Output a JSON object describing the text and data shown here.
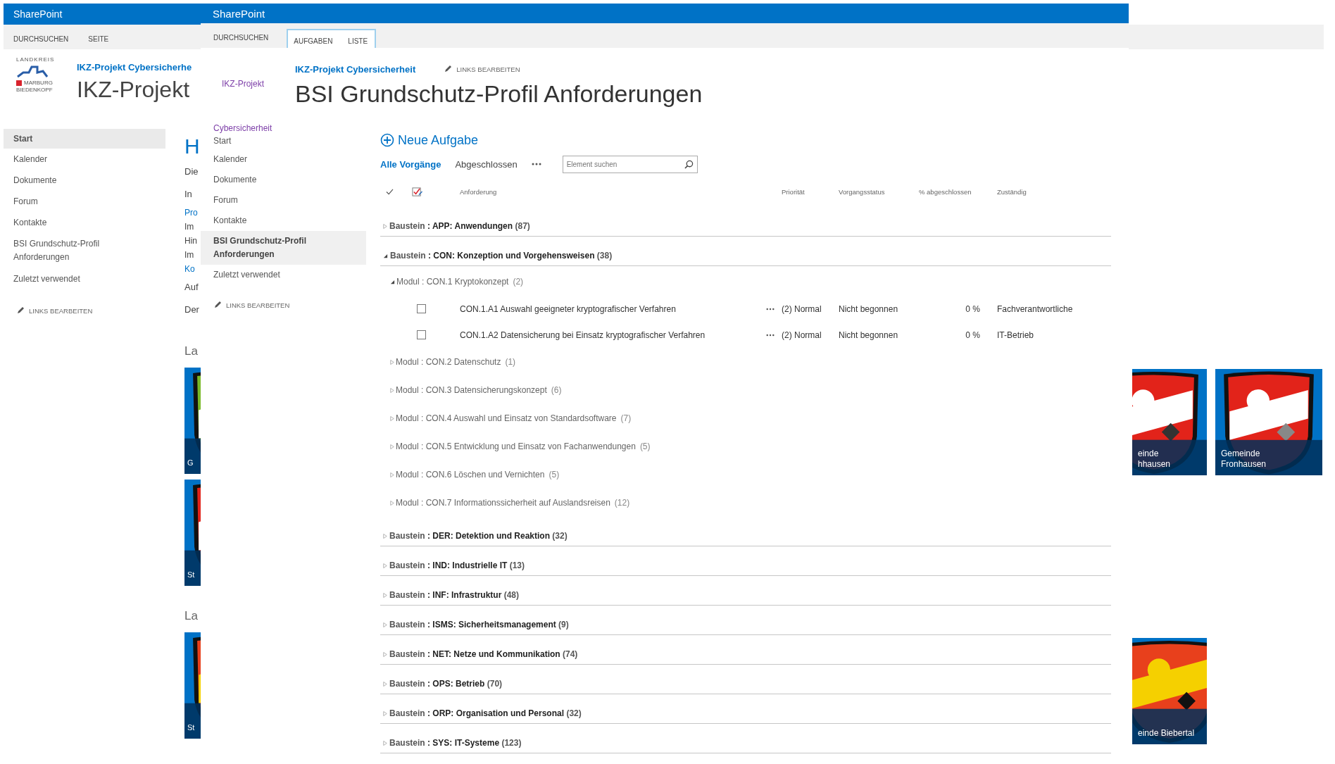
{
  "back_window": {
    "title": "SharePoint",
    "ribbon_tabs": [
      {
        "label": "DURCHSUCHEN",
        "selected": false
      },
      {
        "label": "SEITE",
        "selected": false
      }
    ],
    "logo": {
      "top": "LANDKREIS",
      "lines": [
        "MARBURG",
        "BIEDENKOPF"
      ]
    },
    "site_link": "IKZ-Projekt Cybersicherhe",
    "site_title": "IKZ-Projekt",
    "nav": [
      {
        "label": "Start",
        "selected": true
      },
      {
        "label": "Kalender",
        "selected": false
      },
      {
        "label": "Dokumente",
        "selected": false
      },
      {
        "label": "Forum",
        "selected": false
      },
      {
        "label": "Kontakte",
        "selected": false
      },
      {
        "label": "BSI Grundschutz-Profil Anforderungen",
        "selected": false
      },
      {
        "label": "Zuletzt verwendet",
        "selected": false
      }
    ],
    "edit_links": "LINKS BEARBEITEN",
    "content": [
      {
        "kind": "heading",
        "text": "H"
      },
      {
        "kind": "text",
        "text": "Die"
      },
      {
        "kind": "text",
        "text": "In"
      },
      {
        "kind": "link",
        "text": "Pro"
      },
      {
        "kind": "line",
        "text": "Im"
      },
      {
        "kind": "line",
        "text": "Hin"
      },
      {
        "kind": "line",
        "text": "Im"
      },
      {
        "kind": "link",
        "text": "Ko"
      },
      {
        "kind": "text",
        "text": "Auf"
      },
      {
        "kind": "text",
        "text": "Der"
      },
      {
        "kind": "section",
        "text": "La"
      },
      {
        "kind": "tile",
        "caption": [
          "G"
        ]
      },
      {
        "kind": "tile",
        "caption": [
          "St"
        ]
      },
      {
        "kind": "section",
        "text": "La"
      },
      {
        "kind": "tile",
        "caption": [
          "St"
        ]
      }
    ],
    "tiles": [
      {
        "caption": [
          "einde",
          "hhausen"
        ]
      },
      {
        "caption": [
          "Gemeinde",
          "Fronhausen"
        ]
      },
      {
        "caption": [
          "einde Biebertal"
        ]
      }
    ]
  },
  "front_window": {
    "title": "SharePoint",
    "ribbon_tabs": [
      {
        "label": "DURCHSUCHEN",
        "selected": false,
        "contextual": false
      },
      {
        "label": "AUFGABEN",
        "selected": false,
        "contextual": true
      },
      {
        "label": "LISTE",
        "selected": false,
        "contextual": true
      }
    ],
    "logo_lines": [
      "IKZ-Projekt",
      "Cybersicherheit"
    ],
    "site_link": "IKZ-Projekt Cybersicherheit",
    "edit_links": "LINKS BEARBEITEN",
    "page_title": "BSI Grundschutz-Profil Anforderungen",
    "nav": [
      {
        "label": "Start",
        "selected": false
      },
      {
        "label": "Kalender",
        "selected": false
      },
      {
        "label": "Dokumente",
        "selected": false
      },
      {
        "label": "Forum",
        "selected": false
      },
      {
        "label": "Kontakte",
        "selected": false
      },
      {
        "label": "BSI Grundschutz-Profil Anforderungen",
        "selected": true
      },
      {
        "label": "Zuletzt verwendet",
        "selected": false
      }
    ],
    "nav_edit_links": "LINKS BEARBEITEN",
    "new_task": "Neue Aufgabe",
    "views": [
      {
        "label": "Alle Vorgänge",
        "selected": true
      },
      {
        "label": "Abgeschlossen",
        "selected": false
      }
    ],
    "search": {
      "placeholder": "Element suchen"
    },
    "columns": [
      "Anforderung",
      "Priorität",
      "Vorgangsstatus",
      "% abgeschlossen",
      "Zuständig"
    ],
    "groups": [
      {
        "label": "Baustein **: APP: Anwendungen** (87)",
        "expanded": false
      },
      {
        "label": "Baustein **: CON: Konzeption und Vorgehensweisen** (38)",
        "expanded": true,
        "children": [
          {
            "label": "Modul : CON.1 Kryptokonzept",
            "count": "(2)",
            "expanded": true,
            "items": [
              {
                "checked": false,
                "title": "CON.1.A1 Auswahl geeigneter kryptografischer Verfahren",
                "priority": "(2) Normal",
                "status": "Nicht begonnen",
                "percent": "0 %",
                "assignee": "Fachverantwortliche"
              },
              {
                "checked": false,
                "title": "CON.1.A2 Datensicherung bei Einsatz kryptografischer Verfahren",
                "priority": "(2) Normal",
                "status": "Nicht begonnen",
                "percent": "0 %",
                "assignee": "IT-Betrieb"
              }
            ]
          },
          {
            "label": "Modul : CON.2 Datenschutz",
            "count": "(1)",
            "expanded": false
          },
          {
            "label": "Modul : CON.3 Datensicherungskonzept",
            "count": "(6)",
            "expanded": false
          },
          {
            "label": "Modul : CON.4 Auswahl und Einsatz von Standardsoftware",
            "count": "(7)",
            "expanded": false
          },
          {
            "label": "Modul : CON.5 Entwicklung und Einsatz von Fachanwendungen",
            "count": "(5)",
            "expanded": false
          },
          {
            "label": "Modul : CON.6 Löschen und Vernichten",
            "count": "(5)",
            "expanded": false
          },
          {
            "label": "Modul : CON.7 Informationssicherheit auf Auslandsreisen",
            "count": "(12)",
            "expanded": false
          }
        ]
      },
      {
        "label": "Baustein **: DER: Detektion und Reaktion** (32)",
        "expanded": false
      },
      {
        "label": "Baustein **: IND: Industrielle IT** (13)",
        "expanded": false
      },
      {
        "label": "Baustein **: INF: Infrastruktur** (48)",
        "expanded": false
      },
      {
        "label": "Baustein **: ISMS: Sicherheitsmanagement** (9)",
        "expanded": false
      },
      {
        "label": "Baustein **: NET: Netze und Kommunikation** (74)",
        "expanded": false
      },
      {
        "label": "Baustein **: OPS: Betrieb** (70)",
        "expanded": false
      },
      {
        "label": "Baustein **: ORP: Organisation und Personal** (32)",
        "expanded": false
      },
      {
        "label": "Baustein **: SYS: IT-Systeme** (123)",
        "expanded": false
      }
    ]
  }
}
